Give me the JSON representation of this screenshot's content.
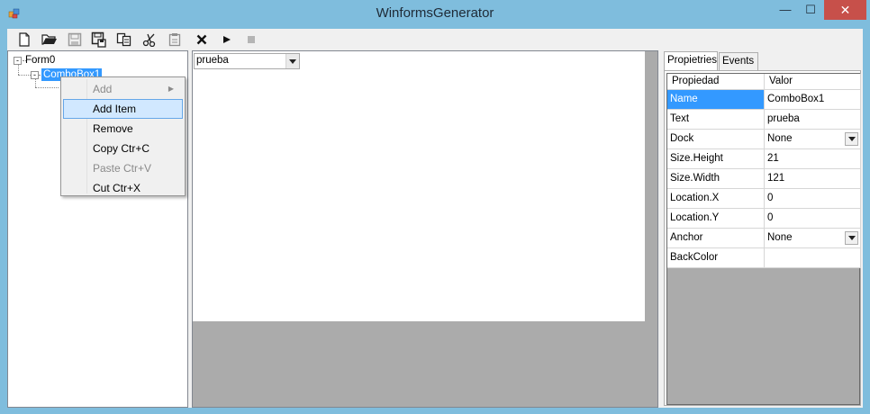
{
  "window": {
    "title": "WinformsGenerator",
    "controls": {
      "minimize": "—",
      "maximize": "☐",
      "close": "✕"
    },
    "close_color": "#c7504a"
  },
  "toolbar": {
    "buttons": [
      {
        "name": "new-file-icon"
      },
      {
        "name": "open-folder-icon"
      },
      {
        "name": "save-disabled-icon"
      },
      {
        "name": "save-as-icon"
      },
      {
        "name": "copy-icon"
      },
      {
        "name": "cut-icon"
      },
      {
        "name": "paste-icon"
      },
      {
        "name": "delete-icon"
      },
      {
        "name": "run-icon"
      },
      {
        "name": "stop-icon"
      }
    ]
  },
  "tree": {
    "root": {
      "label": "Form0",
      "expander": "-"
    },
    "child": {
      "label": "ComboBox1",
      "expander": "-"
    }
  },
  "context_menu": {
    "items": [
      {
        "label": "Add",
        "disabled": true,
        "submenu": true
      },
      {
        "label": "Add Item",
        "disabled": false,
        "hover": true
      },
      {
        "label": "Remove",
        "disabled": false
      },
      {
        "label": "Copy Ctr+C",
        "disabled": false
      },
      {
        "label": "Paste Ctr+V",
        "disabled": true
      },
      {
        "label": "Cut Ctr+X",
        "disabled": false
      }
    ]
  },
  "design": {
    "combo_text": "prueba"
  },
  "properties": {
    "tabs": [
      "Propietries",
      "Events"
    ],
    "headers": {
      "property": "Propiedad",
      "value": "Valor"
    },
    "rows": [
      {
        "name": "Name",
        "value": "ComboBox1",
        "selected": true
      },
      {
        "name": "Text",
        "value": "prueba"
      },
      {
        "name": "Dock",
        "value": "None",
        "dropdown": true
      },
      {
        "name": "Size.Height",
        "value": "21"
      },
      {
        "name": "Size.Width",
        "value": "121"
      },
      {
        "name": "Location.X",
        "value": "0"
      },
      {
        "name": "Location.Y",
        "value": "0"
      },
      {
        "name": "Anchor",
        "value": "None",
        "dropdown": true
      },
      {
        "name": "BackColor",
        "value": ""
      }
    ],
    "selection_color": "#3399ff"
  }
}
